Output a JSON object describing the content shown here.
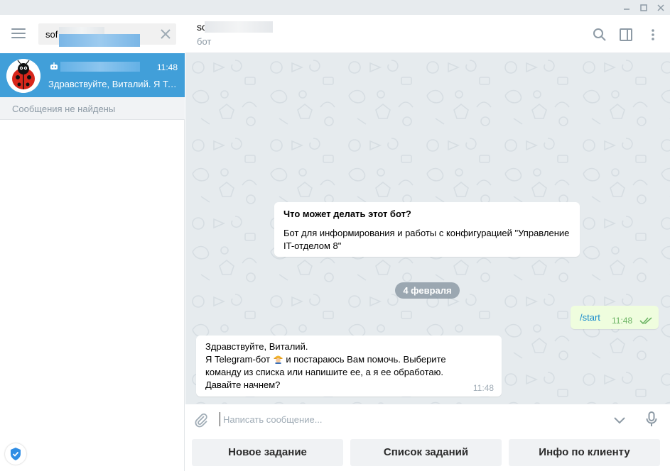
{
  "search": {
    "value": "sof",
    "placeholder": ""
  },
  "chat_list": {
    "items": [
      {
        "time": "11:48",
        "preview": "Здравствуйте, Виталий. Я Telegram-бот"
      }
    ],
    "no_messages": "Сообщения не найдены"
  },
  "chat_header": {
    "name_visible": "so",
    "status": "бот"
  },
  "bot_info": {
    "title": "Что может делать этот бот?",
    "description": "Бот для информирования и работы с конфигурацией \"Управление IT-отделом 8\""
  },
  "date_separator": "4 февраля",
  "messages": [
    {
      "direction": "out",
      "text": "/start",
      "time": "11:48",
      "status": "read"
    },
    {
      "direction": "in",
      "lines": [
        "Здравствуйте, Виталий.",
        "Я Telegram-бот",
        "и постараюсь Вам помочь. Выберите",
        "команду из списка или напишите ее, а я ее обработаю.",
        "Давайте начнем?"
      ],
      "emoji": "worker-emoji",
      "time": "11:48"
    }
  ],
  "composer": {
    "placeholder": "Написать сообщение..."
  },
  "keyboard": {
    "buttons": [
      "Новое задание",
      "Список заданий",
      "Инфо по клиенту"
    ]
  },
  "icons": [
    "minimize-icon",
    "maximize-icon",
    "close-icon",
    "menu-icon",
    "clear-icon",
    "bot-icon",
    "search-icon",
    "sidebar-icon",
    "more-icon",
    "attach-icon",
    "chevron-down-icon",
    "mic-icon",
    "shield-icon"
  ],
  "colors": {
    "accent": "#419fd9",
    "out_bubble": "#effdde",
    "pattern_bg": "#e6ebee",
    "link": "#168acd"
  }
}
